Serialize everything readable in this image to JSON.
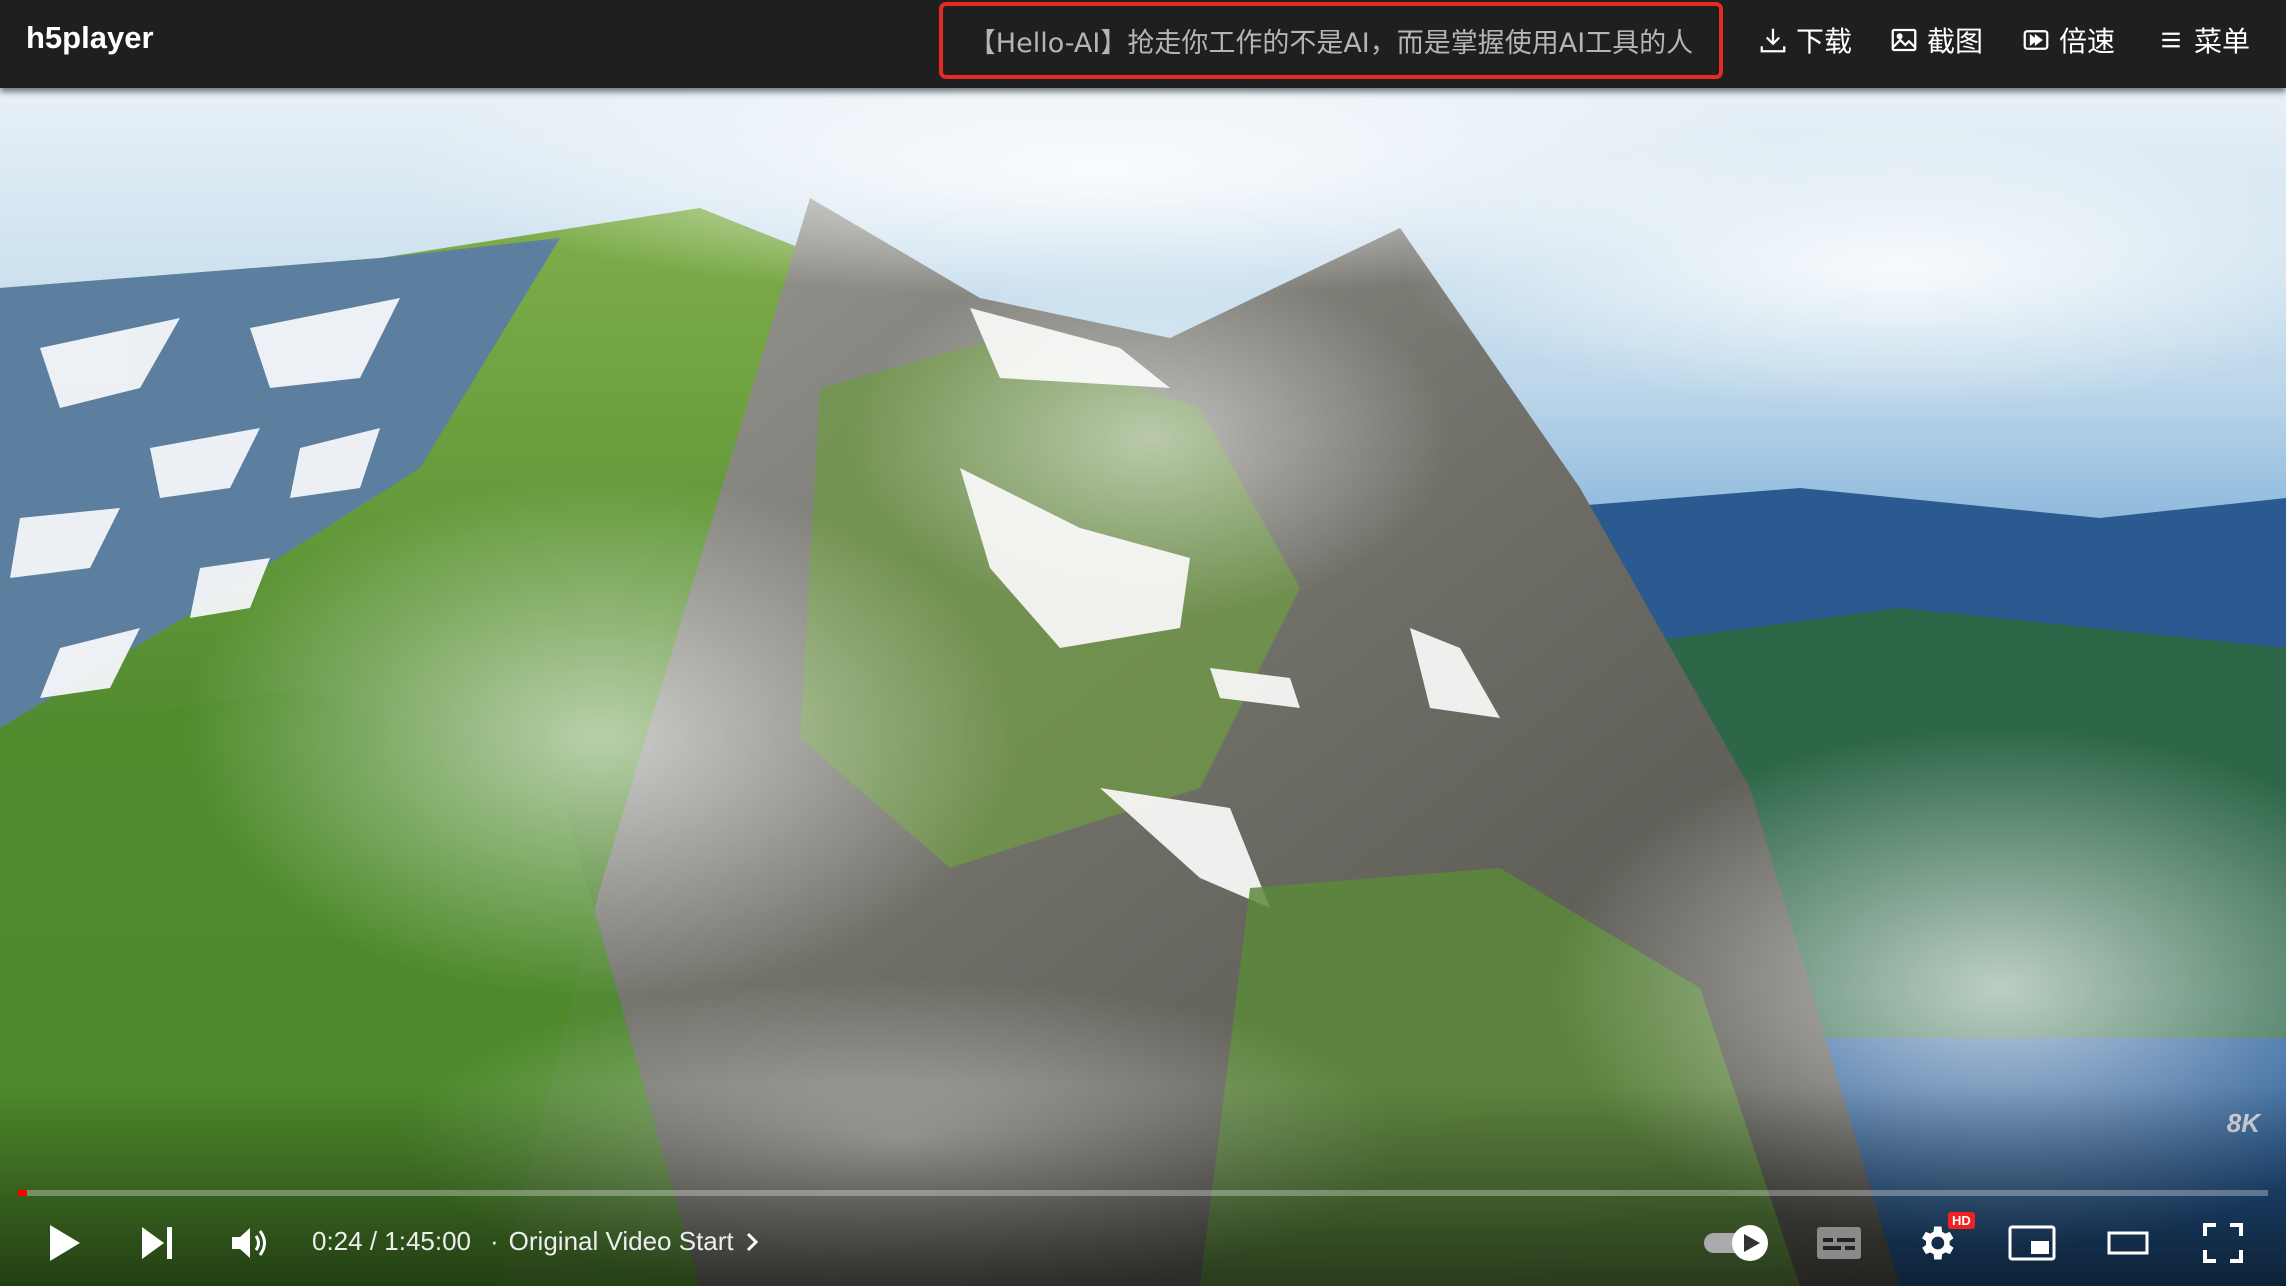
{
  "app": {
    "brand": "h5player"
  },
  "notice": {
    "text": "【Hello-AI】抢走你工作的不是AI，而是掌握使用AI工具的人"
  },
  "toolbar": {
    "download_label": "下载",
    "screenshot_label": "截图",
    "speed_label": "倍速",
    "menu_label": "菜单"
  },
  "video": {
    "watermark": "8K",
    "current_time": "0:24",
    "duration": "1:45:00",
    "time_display": "0:24 / 1:45:00",
    "chapter_separator": "·",
    "chapter_label": "Original Video Start",
    "progress": 0.004,
    "quality_badge": "HD"
  },
  "colors": {
    "accent": "#ff0000",
    "notice_border": "#e52a24",
    "topbar_bg": "#1f1f1f"
  },
  "icons": [
    "download-icon",
    "image-icon",
    "speed-icon",
    "menu-icon",
    "play-icon",
    "next-icon",
    "volume-icon",
    "chevron-right-icon",
    "autoplay-toggle-icon",
    "subtitles-icon",
    "settings-icon",
    "miniplayer-icon",
    "theater-icon",
    "fullscreen-icon"
  ]
}
